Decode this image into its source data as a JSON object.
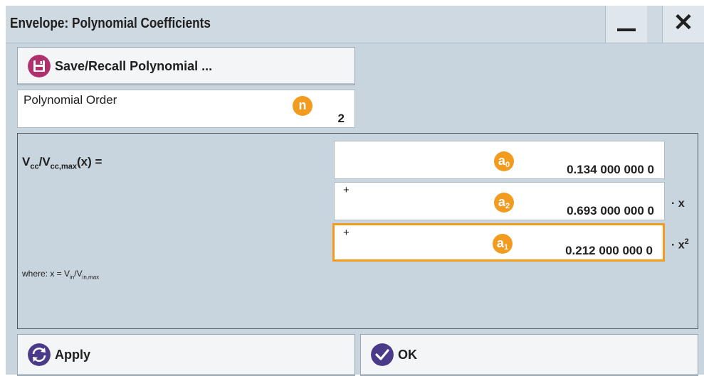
{
  "window": {
    "title": "Envelope: Polynomial Coefficients",
    "minimize_icon": "minimize-icon",
    "close_icon": "close-icon",
    "close_glyph": "✕"
  },
  "save_button": {
    "label": "Save/Recall Polynomial ...",
    "icon": "floppy-disk-icon",
    "icon_color": "#b0306e"
  },
  "polynomial_order": {
    "label": "Polynomial Order",
    "badge": "n",
    "value": "2"
  },
  "formula": {
    "lhs_main": "V",
    "lhs_sub1": "cc",
    "lhs_mid": "/V",
    "lhs_sub2": "cc,max",
    "lhs_tail": "(x) =",
    "where_prefix": "where: x = V",
    "where_sub1": "in",
    "where_mid": "/V",
    "where_sub2": "in,max"
  },
  "coefficients": [
    {
      "prefix": "",
      "badge": "a",
      "badge_sub": "0",
      "value": "0.134 000 000 0",
      "suffix": "",
      "suffix_sup": ""
    },
    {
      "prefix": "+",
      "badge": "a",
      "badge_sub": "2",
      "value": "0.693 000 000 0",
      "suffix": "· x",
      "suffix_sup": ""
    },
    {
      "prefix": "+",
      "badge": "a",
      "badge_sub": "1",
      "value": "0.212 000 000 0",
      "suffix": "· x",
      "suffix_sup": "2"
    }
  ],
  "footer": {
    "apply_label": "Apply",
    "apply_icon": "refresh-icon",
    "apply_icon_color": "#4a3a8a",
    "ok_label": "OK",
    "ok_icon": "checkmark-icon",
    "ok_icon_color": "#4a3a8a"
  },
  "colors": {
    "accent_orange": "#f29b1e",
    "background": "#c8d4de"
  }
}
